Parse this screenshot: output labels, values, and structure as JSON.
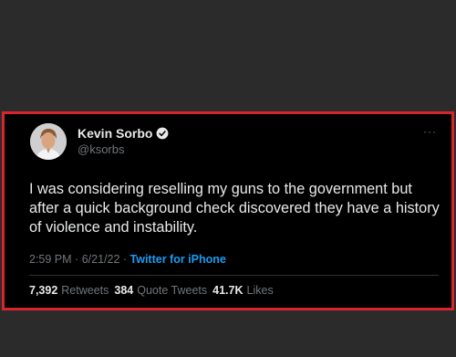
{
  "tweet": {
    "display_name": "Kevin Sorbo",
    "handle": "@ksorbs",
    "text": "I was considering reselling my guns to the government but after a quick background check discovered they have a history of violence and instability.",
    "time": "2:59 PM",
    "date": "6/21/22",
    "source": "Twitter for iPhone",
    "stats": {
      "retweets_count": "7,392",
      "retweets_label": "Retweets",
      "quotes_count": "384",
      "quotes_label": "Quote Tweets",
      "likes_count": "41.7K",
      "likes_label": "Likes"
    }
  },
  "icons": {
    "verified": "verified-badge-icon",
    "more": "more-options-icon"
  },
  "colors": {
    "frame_border": "#d9232d",
    "link_blue": "#1d9bf0"
  }
}
